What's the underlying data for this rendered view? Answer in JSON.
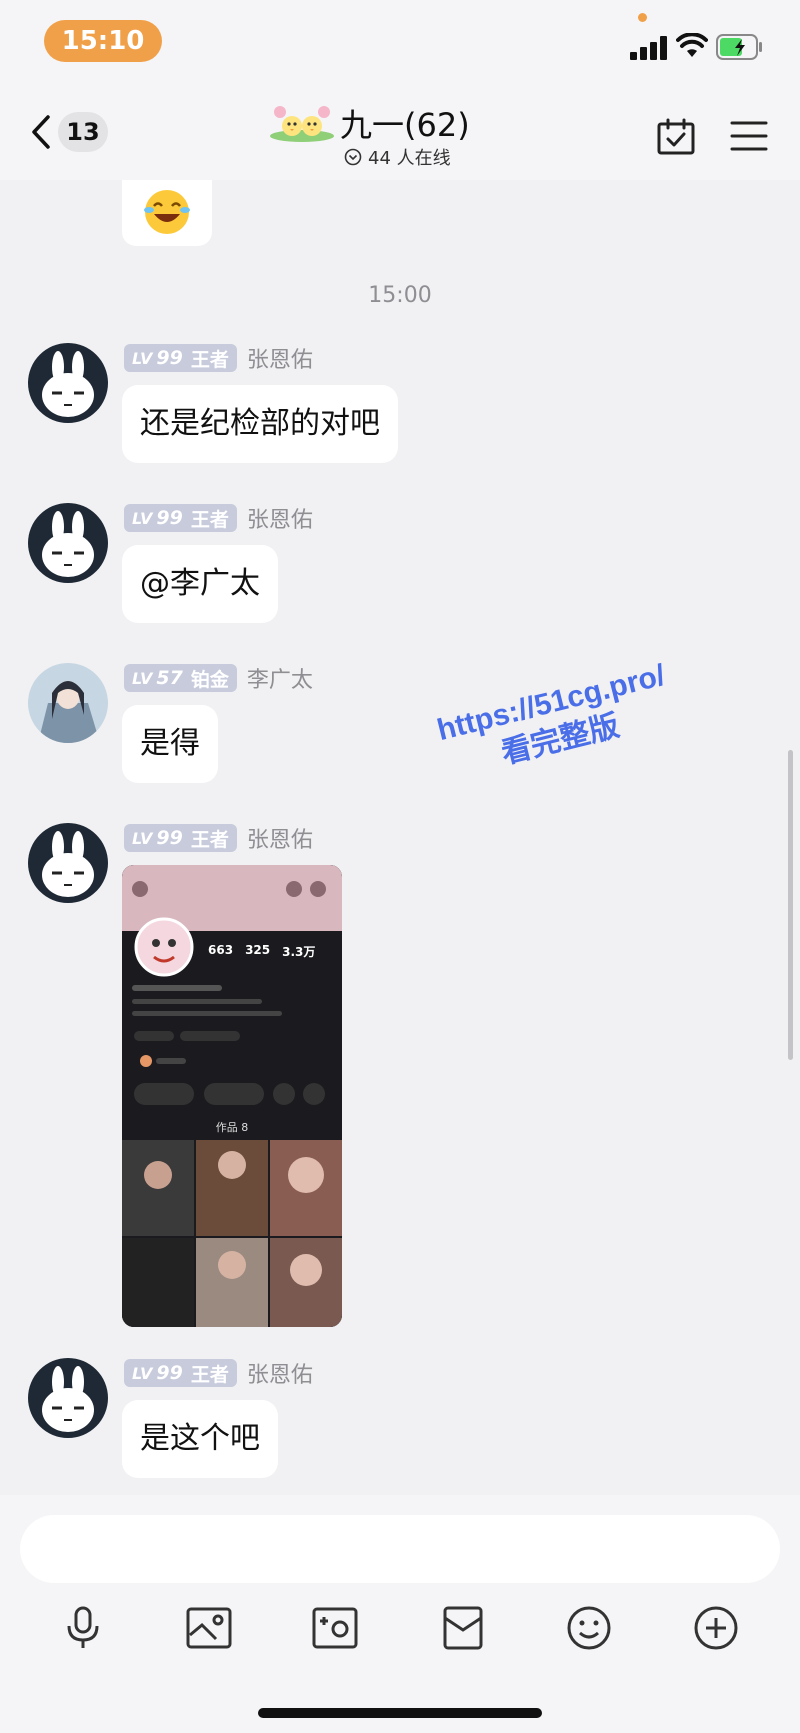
{
  "status_bar": {
    "time": "15:10"
  },
  "header": {
    "back_count": "13",
    "group_name": "九一(62)",
    "online_text": "44 人在线"
  },
  "chat": {
    "timestamp": "15:00",
    "messages": [
      {
        "level_prefix": "LV",
        "level_num": "99",
        "rank": "王者",
        "sender": "张恩佑",
        "text": "还是纪检部的对吧"
      },
      {
        "level_prefix": "LV",
        "level_num": "99",
        "rank": "王者",
        "sender": "张恩佑",
        "text": "@李广太"
      },
      {
        "level_prefix": "LV",
        "level_num": "57",
        "rank": "铂金",
        "sender": "李广太",
        "text": "是得"
      },
      {
        "level_prefix": "LV",
        "level_num": "99",
        "rank": "王者",
        "sender": "张恩佑",
        "text": ""
      },
      {
        "level_prefix": "LV",
        "level_num": "99",
        "rank": "王者",
        "sender": "张恩佑",
        "text": "是这个吧"
      }
    ]
  },
  "screenshot_image": {
    "stats": [
      {
        "value": "663"
      },
      {
        "value": "325"
      },
      {
        "value": "3.3万"
      }
    ],
    "works_label": "作品 8"
  },
  "watermark": {
    "line1": "https://51cg.pro/",
    "line2": "看完整版"
  },
  "input": {
    "placeholder": ""
  },
  "toolbar": {
    "icons": [
      "microphone-icon",
      "image-icon",
      "camera-icon",
      "red-packet-icon",
      "emoji-icon",
      "plus-icon"
    ]
  },
  "colors": {
    "time_pill": "#f1a04a",
    "level_badge": "#c7cbdc",
    "watermark": "#4a6ee8"
  }
}
